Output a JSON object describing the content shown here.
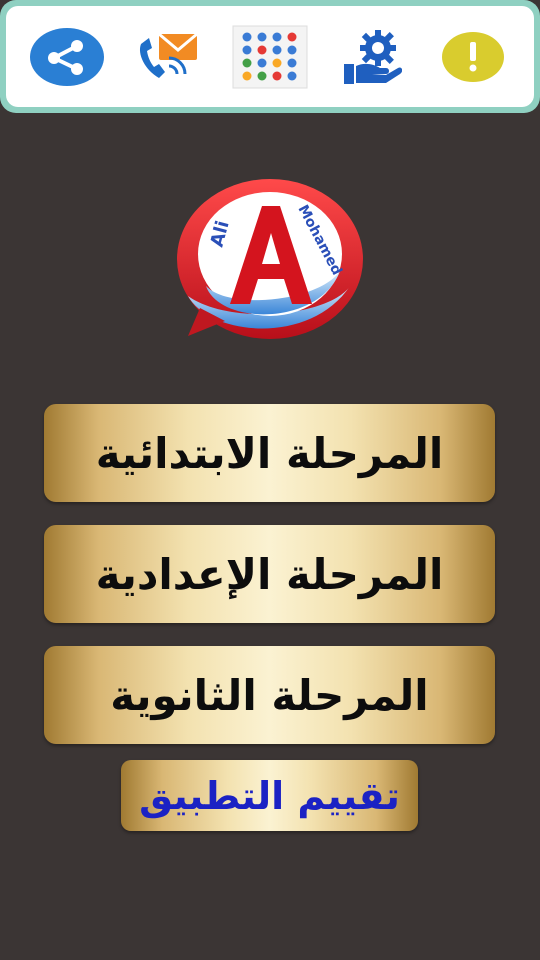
{
  "toolbar": {
    "items": [
      {
        "icon": "share-icon",
        "color": "#2a7fd4"
      },
      {
        "icon": "contact-icon",
        "color": "#2a7fd4"
      },
      {
        "icon": "more-apps-icon",
        "color": "#3a7bd5"
      },
      {
        "icon": "settings-icon",
        "color": "#1f5fbf"
      },
      {
        "icon": "info-icon",
        "color": "#d9cc2e"
      }
    ],
    "border_color": "#8fd0c1"
  },
  "logo": {
    "letter": "A",
    "left_text": "Ali",
    "right_text": "Mohamed"
  },
  "stages": [
    {
      "label": "المرحلة الابتدائية"
    },
    {
      "label": "المرحلة الإعدادية"
    },
    {
      "label": "المرحلة الثانوية"
    }
  ],
  "rate": {
    "label": "تقييم التطبيق",
    "color": "#1b22c4"
  },
  "colors": {
    "background": "#3b3534",
    "gold": "#d9b774"
  }
}
